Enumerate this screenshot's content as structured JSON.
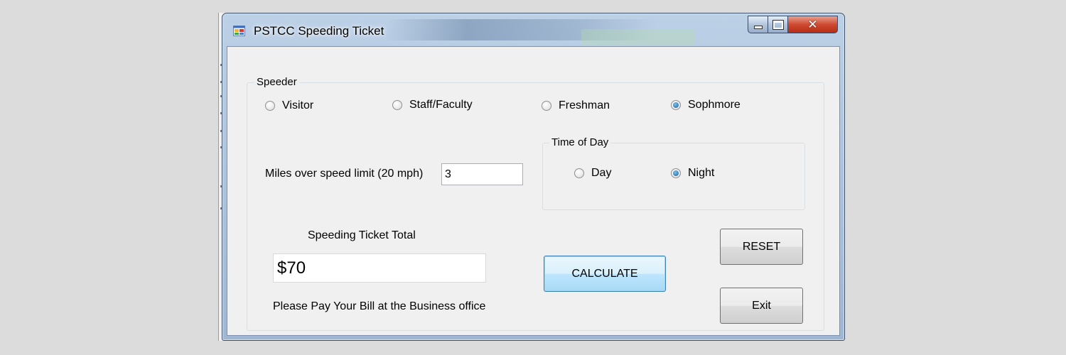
{
  "window": {
    "title": "PSTCC Speeding Ticket",
    "icon": "app-form-icon",
    "controls": [
      "minimize-icon",
      "maximize-icon",
      "close-icon"
    ],
    "close_glyph": "✕"
  },
  "speeder": {
    "group_label": "Speeder",
    "options": [
      {
        "label": "Visitor",
        "checked": false
      },
      {
        "label": "Staff/Faculty",
        "checked": false
      },
      {
        "label": "Freshman",
        "checked": false
      },
      {
        "label": "Sophmore",
        "checked": true
      }
    ]
  },
  "time_of_day": {
    "group_label": "Time of Day",
    "options": [
      {
        "label": "Day",
        "checked": false
      },
      {
        "label": "Night",
        "checked": true
      }
    ]
  },
  "miles": {
    "label": "Miles over speed limit (20 mph)",
    "value": "3"
  },
  "total": {
    "label": "Speeding Ticket Total",
    "value": "$70",
    "message": "Please Pay Your Bill at the Business office"
  },
  "buttons": {
    "calculate": "CALCULATE",
    "reset": "RESET",
    "exit": "Exit"
  }
}
